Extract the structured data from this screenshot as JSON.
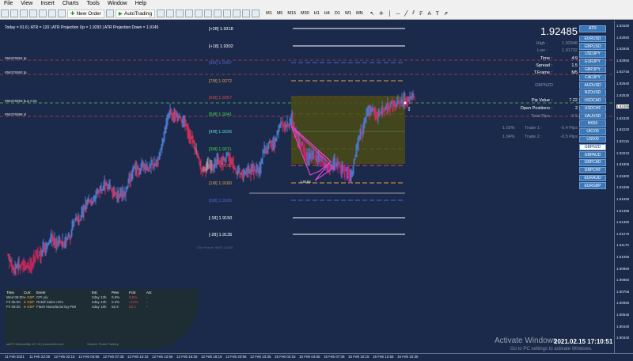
{
  "menu": [
    "File",
    "View",
    "Insert",
    "Charts",
    "Tools",
    "Window",
    "Help"
  ],
  "toolbar": {
    "new_order": "New Order",
    "autotrading": "AutoTrading",
    "timeframes": [
      "M1",
      "M5",
      "M15",
      "M30",
      "H1",
      "H4",
      "D1",
      "W1",
      "MN"
    ]
  },
  "info_line": "Today = 91.6  |  ATR = 120  |  ATR Projection Up = 1.9293  |  ATR Projection Down = 1.9145",
  "colors": {
    "bg": "#1b2a4a",
    "bull": "#4a78c8",
    "bear": "#c8305a",
    "neutral": "#8a8f9a",
    "zone": "#4a4a14",
    "symbol_btn": "#3c78b8"
  },
  "levels": [
    {
      "label": "[+28]  1.9318",
      "color": "#ffffff"
    },
    {
      "label": "[+18]  1.9302",
      "color": "#ffffff"
    },
    {
      "label": "[8/8]  1.9287",
      "color": "#4a68d8"
    },
    {
      "label": "[7/8]  1.9272",
      "color": "#e8a048"
    },
    {
      "label": "[6/8]  1.9257",
      "color": "#e04848"
    },
    {
      "label": "[5/8]  1.9241",
      "color": "#48e048"
    },
    {
      "label": "[4/8]  1.9226",
      "color": "#58e0d8"
    },
    {
      "label": "[3/8]  1.9211",
      "color": "#48e048"
    },
    {
      "label": "[2/8]  1.9196",
      "color": "#e04848"
    },
    {
      "label": "[1/8]  1.9180",
      "color": "#e8a048"
    },
    {
      "label": "[0/8]  1.9165",
      "color": "#4a68d8"
    },
    {
      "label": "[-18]  1.9150",
      "color": "#ffffff"
    },
    {
      "label": "[-28]  1.9135",
      "color": "#ffffff"
    }
  ],
  "level_note": "1/3rd Frame: 9600  1.9180",
  "hline_labels": [
    "#56376094 tp",
    "#56376093 tp",
    "#56376093 buy 0.01",
    "#56376098 sl"
  ],
  "fib_label": "1.9184",
  "panel": {
    "price": "1.92485",
    "high_label": "High :",
    "high": "1.92948",
    "low_label": "Low :",
    "low": "1.91732",
    "time_label": "Time :",
    "time": "4:9",
    "spread_label": "Spread :",
    "spread": "1.5",
    "tframe_label": "T.Frame :",
    "tframe": "M5",
    "symbol": "GBPNZD",
    "pipvalue_label": "Pip Value :",
    "pipvalue": "7.22",
    "openpos_label": "Open Positions :",
    "openpos": "2",
    "totalpips_label": "Total Pips :",
    "totalpips": "-0.5",
    "trade1_pct": "1.02%",
    "trade1_label": "Trade 1 :",
    "trade1": "-0.4 Pips",
    "trade2_pct": "1.04%",
    "trade2_label": "Trade 2 :",
    "trade2": "-0.5 Pips"
  },
  "atr_button": "ATR",
  "symbols": [
    "EURUSD",
    "GBPUSD",
    "USDJPY",
    "EURJPY",
    "GBPJPY",
    "CADJPY",
    "AUDUSD",
    "NZDUSD",
    "USDCAD",
    "USDCHF",
    "XAUUSD",
    "HK50",
    "UK100",
    "US500",
    "GBPNZD",
    "GBPAUD",
    "GBPCAD",
    "GBPCHF",
    "EURAUD",
    "EURGBP"
  ],
  "active_symbol": "GBPNZD",
  "price_scale": [
    "1.93160",
    "1.93050",
    "1.92945",
    "1.92850",
    "1.92745",
    "1.92640",
    "1.92535",
    "1.92485",
    "1.92330",
    "1.92220",
    "1.92115",
    "1.92010",
    "1.91905",
    "1.91800",
    "1.91695",
    "1.91590",
    "1.91485",
    "1.91380",
    "1.91275",
    "1.91170",
    "1.91065",
    "1.90960",
    "1.90860",
    "1.90755",
    "1.90650",
    "1.90545",
    "1.90440",
    "1.90340"
  ],
  "time_axis": [
    "11 Feb 2021",
    "11 Feb 23:35",
    "12 Feb 02:15",
    "12 Feb 04:55",
    "12 Feb 07:35",
    "12 Feb 10:15",
    "12 Feb 12:55",
    "12 Feb 15:35",
    "12 Feb 18:15",
    "12 Feb 20:55",
    "12 Feb 23:35",
    "15 Feb 02:15",
    "15 Feb 04:55",
    "15 Feb 07:35",
    "15 Feb 10:15",
    "15 Feb 12:55",
    "15 Feb 15:35"
  ],
  "news": {
    "headers": [
      "Time",
      "Curr.",
      "Event",
      "Est.",
      "Prev",
      "Fcst",
      "Act"
    ],
    "rows": [
      [
        "Wed 06:00",
        "GBP",
        "CPI y/y",
        "2day 13h",
        "0.6%",
        "0.5%",
        "-"
      ],
      [
        "Fri 06:00",
        "GBP",
        "Retail Sales m/m",
        "4day 13h",
        "0.3%",
        "-2.6%",
        "-"
      ],
      [
        "Fri 08:30",
        "GBP",
        "Flash Manufacturing PMI",
        "4day 15h",
        "52.9",
        "53.1",
        "-"
      ]
    ]
  },
  "footer_left": "ianFX Newsutility v2.7.8  |  www.ianfx.com",
  "footer_mid": "Source: Forex Factory",
  "clock": "2021.02.15 17:10:51",
  "watermark1": "Activate Windows",
  "watermark2": "Go to PC settings to activate Windows."
}
